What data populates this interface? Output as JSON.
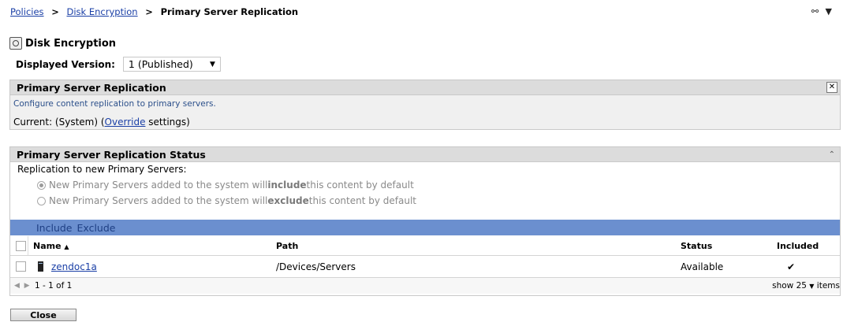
{
  "breadcrumb": {
    "item1": "Policies",
    "sep1": ">",
    "item2": "Disk Encryption",
    "sep2": ">",
    "current": "Primary Server Replication"
  },
  "top_right": {
    "glasses_glyph": "⚯",
    "caret": "▼"
  },
  "page_title": "Disk Encryption",
  "version": {
    "label": "Displayed Version:",
    "value": "1 (Published)"
  },
  "replication_panel": {
    "title": "Primary Server Replication",
    "description": "Configure content replication to primary servers.",
    "current_prefix": "Current:  (System)  (",
    "override_link": "Override",
    "current_suffix": " settings)"
  },
  "status_panel": {
    "title": "Primary Server Replication Status",
    "replication_label": "Replication to new Primary Servers:",
    "option_include": {
      "before": "New Primary Servers added to the system will ",
      "bold": "include",
      "after": " this content by default"
    },
    "option_exclude": {
      "before": "New Primary Servers added to the system will ",
      "bold": "exclude",
      "after": " this content by default"
    },
    "actions": {
      "include": "Include",
      "exclude": "Exclude"
    },
    "columns": {
      "name": "Name",
      "sort_indicator": "▲",
      "path": "Path",
      "status": "Status",
      "included": "Included"
    },
    "rows": [
      {
        "name": "zendoc1a",
        "path": "/Devices/Servers",
        "status": "Available",
        "included": "✔"
      }
    ],
    "pager": {
      "range": "1 - 1 of 1",
      "show": "show",
      "count": "25",
      "items": "items"
    }
  },
  "close_button": "Close"
}
